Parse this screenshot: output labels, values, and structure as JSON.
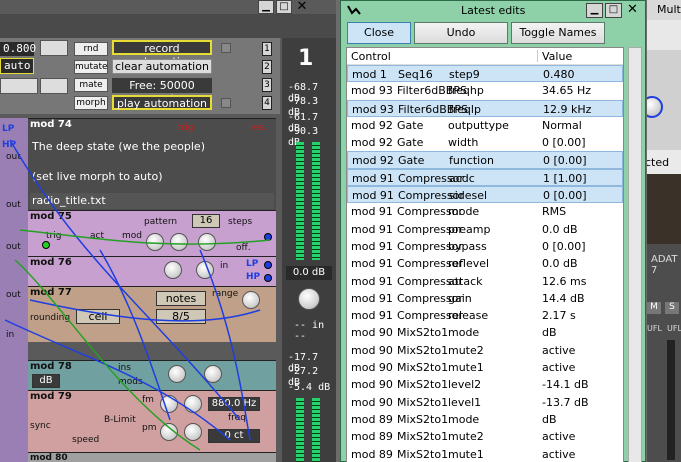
{
  "window_controls": [
    "▁",
    "□",
    "✕"
  ],
  "automation": {
    "value": "0.800",
    "mode": "auto",
    "small_buttons": [
      "rnd",
      "mutate",
      "mate",
      "morph"
    ],
    "buttons": [
      "record automation",
      "clear automation",
      "Free: 50000 events",
      "play automation"
    ],
    "numbers": [
      "1",
      "2",
      "3",
      "4"
    ]
  },
  "meter": {
    "big_number": "1",
    "readings_top": [
      "-68.7 dB",
      "-78.3 dB",
      "-61.7 dB",
      "-90.3 dB"
    ],
    "level": "0.0 dB",
    "io": "-- in --",
    "readings_bottom": [
      "-17.7 dB",
      "-27.2 dB",
      "-5.4 dB"
    ]
  },
  "modules": {
    "mod74": {
      "title": "mod 74",
      "trig": "trig",
      "res": "res.",
      "text": [
        "The deep state (we the people)",
        "",
        "(set live morph to auto)"
      ],
      "file": "radio_title.txt"
    },
    "mod75": {
      "title": "mod 75",
      "pattern": "pattern",
      "steps_value": "16",
      "steps": "steps",
      "trig": "trig",
      "act": "act",
      "mod": "mod",
      "off": "off."
    },
    "mod76": {
      "title": "mod 76",
      "in": "in",
      "lp": "LP",
      "hp": "HP"
    },
    "mod77": {
      "title": "mod 77",
      "range": "range",
      "rounding": "rounding",
      "ceil": "ceil",
      "notes": "notes",
      "ratio": "8/5"
    },
    "mod78": {
      "title": "mod 78",
      "db": "dB",
      "ins": "ins",
      "mods": "mods"
    },
    "mod79": {
      "title": "mod 79",
      "blimit": "B-Limit",
      "fm": "fm",
      "pm": "pm",
      "sync": "sync",
      "speed": "speed",
      "freq_value": "880.0 Hz",
      "freq": "freq",
      "ct": "0 ct"
    },
    "mod80": {
      "title": "mod 80"
    },
    "side_labels": [
      "LP",
      "HP",
      "out",
      "out",
      "out",
      "out",
      "in"
    ]
  },
  "edits_window": {
    "title": "Latest edits",
    "toolbar": {
      "close": "Close",
      "undo": "Undo selection",
      "toggle": "Toggle Names"
    },
    "columns": {
      "control": "Control",
      "value": "Value"
    },
    "rows": [
      {
        "mod": "mod 1",
        "module": "Seq16",
        "param": "step9",
        "value": "0.480",
        "hl": true
      },
      {
        "mod": "mod 93",
        "module": "Filter6dBBPS",
        "param": "freqhp",
        "value": "34.65 Hz",
        "hl": false
      },
      {
        "mod": "mod 93",
        "module": "Filter6dBBPS",
        "param": "freqlp",
        "value": "12.9 kHz",
        "hl": true
      },
      {
        "mod": "mod 92",
        "module": "Gate",
        "param": "outputtype",
        "value": "Normal",
        "hl": false
      },
      {
        "mod": "mod 92",
        "module": "Gate",
        "param": "width",
        "value": "0 [0.00]",
        "hl": false
      },
      {
        "mod": "mod 92",
        "module": "Gate",
        "param": "function",
        "value": "0 [0.00]",
        "hl": true
      },
      {
        "mod": "mod 91",
        "module": "Compressor",
        "param": "acdc",
        "value": "1 [1.00]",
        "hl": true
      },
      {
        "mod": "mod 91",
        "module": "Compressor",
        "param": "sidesel",
        "value": "0 [0.00]",
        "hl": true
      },
      {
        "mod": "mod 91",
        "module": "Compressor",
        "param": "mode",
        "value": "RMS",
        "hl": false
      },
      {
        "mod": "mod 91",
        "module": "Compressor",
        "param": "preamp",
        "value": "0.0 dB",
        "hl": false
      },
      {
        "mod": "mod 91",
        "module": "Compressor",
        "param": "bypass",
        "value": "0 [0.00]",
        "hl": false
      },
      {
        "mod": "mod 91",
        "module": "Compressor",
        "param": "reflevel",
        "value": "0.0 dB",
        "hl": false
      },
      {
        "mod": "mod 91",
        "module": "Compressor",
        "param": "attack",
        "value": "12.6 ms",
        "hl": false
      },
      {
        "mod": "mod 91",
        "module": "Compressor",
        "param": "gain",
        "value": "14.4 dB",
        "hl": false
      },
      {
        "mod": "mod 91",
        "module": "Compressor",
        "param": "release",
        "value": "2.17 s",
        "hl": false
      },
      {
        "mod": "mod 90",
        "module": "MixS2to1",
        "param": "mode",
        "value": "dB",
        "hl": false
      },
      {
        "mod": "mod 90",
        "module": "MixS2to1",
        "param": "mute2",
        "value": "active",
        "hl": false
      },
      {
        "mod": "mod 90",
        "module": "MixS2to1",
        "param": "mute1",
        "value": "active",
        "hl": false
      },
      {
        "mod": "mod 90",
        "module": "MixS2to1",
        "param": "level2",
        "value": "-14.1 dB",
        "hl": false
      },
      {
        "mod": "mod 90",
        "module": "MixS2to1",
        "param": "level1",
        "value": "-13.7 dB",
        "hl": false
      },
      {
        "mod": "mod 89",
        "module": "MixS2to1",
        "param": "mode",
        "value": "dB",
        "hl": false
      },
      {
        "mod": "mod 89",
        "module": "MixS2to1",
        "param": "mute2",
        "value": "active",
        "hl": false
      },
      {
        "mod": "mod 89",
        "module": "MixS2to1",
        "param": "mute1",
        "value": "active",
        "hl": false
      },
      {
        "mod": "mod 89",
        "module": "MixS2to1",
        "param": "level2",
        "value": "-14.1 dB",
        "hl": false
      }
    ]
  },
  "right_bg": {
    "title": "Mult",
    "text1": "cted",
    "adat": "ADAT 7",
    "m": "M",
    "s": "S",
    "ufl": "UFL",
    "ufl2": "UFL"
  },
  "colors": {
    "edits_bg": "#8ed0a8",
    "highlight": "#cde4f7",
    "jack_green": "#24d024",
    "jack_blue": "#1f3ee0",
    "accent_yellow": "#e6dc32"
  }
}
